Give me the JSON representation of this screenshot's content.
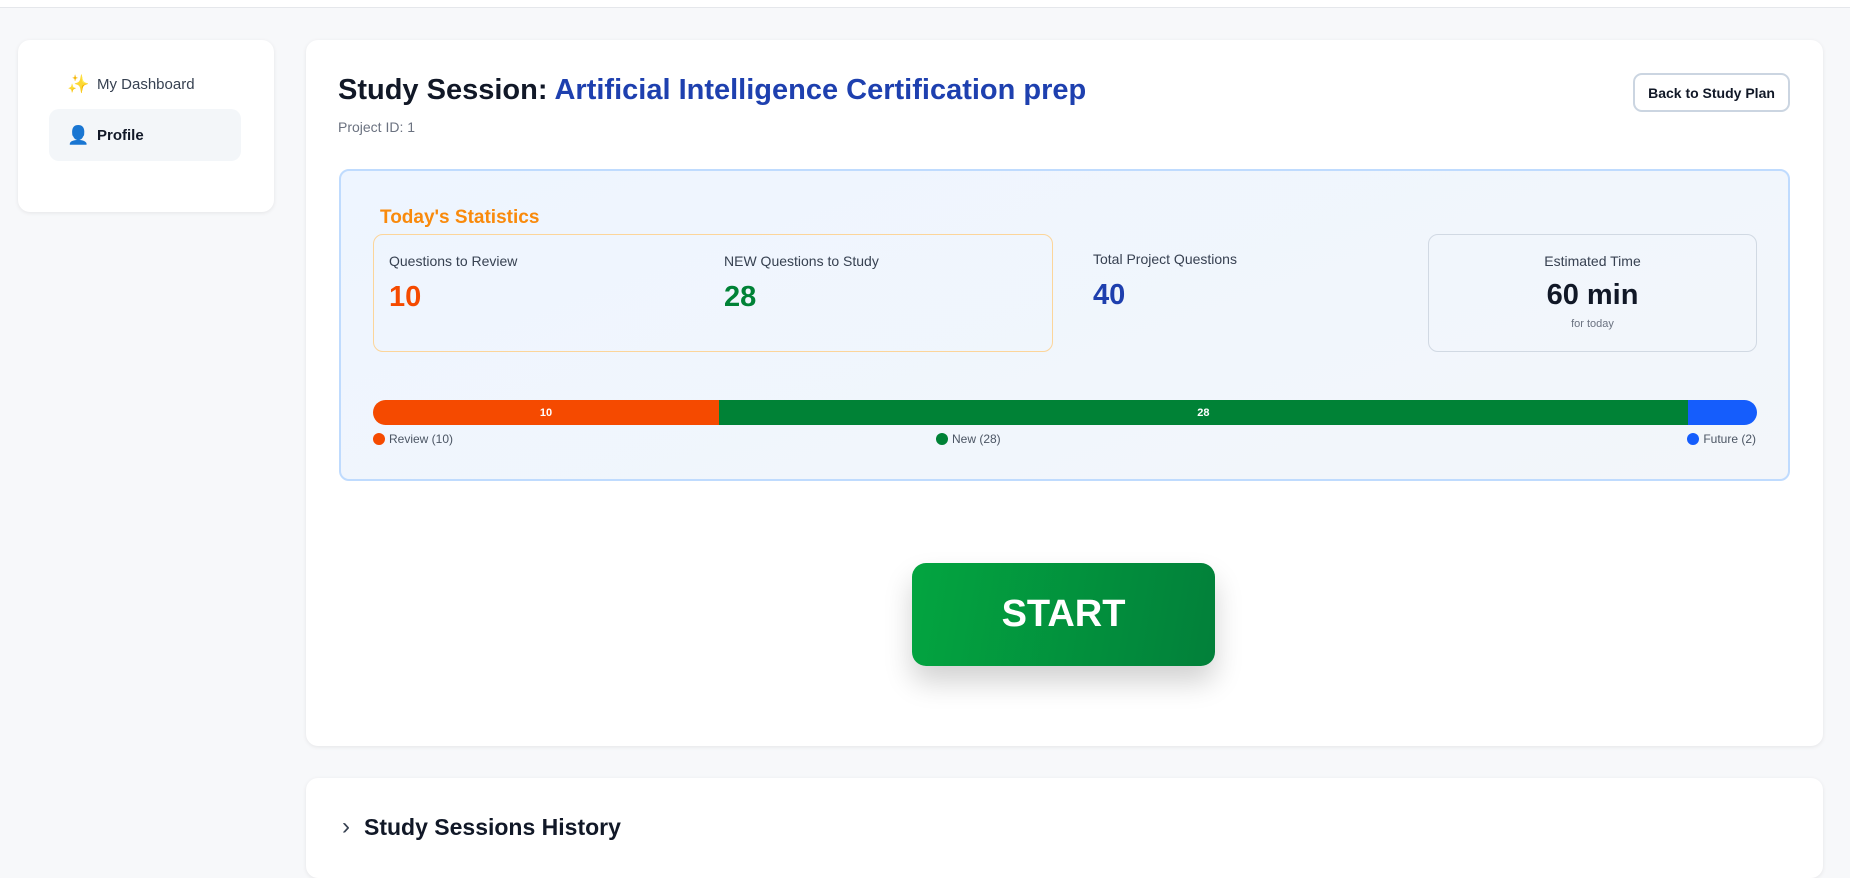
{
  "sidebar": {
    "items": [
      {
        "label": "My Dashboard",
        "icon": "sparkles-icon",
        "glyph": "✨"
      },
      {
        "label": "Profile",
        "icon": "user-icon",
        "glyph": "👤"
      }
    ]
  },
  "header": {
    "title_prefix": "Study Session:",
    "project_name": "Artificial Intelligence Certification prep",
    "project_id": "Project ID: 1",
    "back_label": "Back to Study Plan"
  },
  "stats": {
    "heading": "Today's Statistics",
    "review_label": "Questions to Review",
    "review_value": "10",
    "new_label": "NEW Questions to Study",
    "new_value": "28",
    "total_label": "Total Project Questions",
    "total_value": "40",
    "time_label": "Estimated Time",
    "time_value": "60 min",
    "time_sub": "for today"
  },
  "progress": {
    "total": 40,
    "segments": [
      {
        "name": "review",
        "value": 10,
        "label": "10",
        "legend": "Review (10)",
        "color": "#f54a00"
      },
      {
        "name": "new",
        "value": 28,
        "label": "28",
        "legend": "New (28)",
        "color": "#008236"
      },
      {
        "name": "future",
        "value": 2,
        "label": "",
        "legend": "Future (2)",
        "color": "#155dfc"
      }
    ]
  },
  "start_label": "START",
  "history": {
    "title": "Study Sessions History",
    "chevron": "›"
  }
}
